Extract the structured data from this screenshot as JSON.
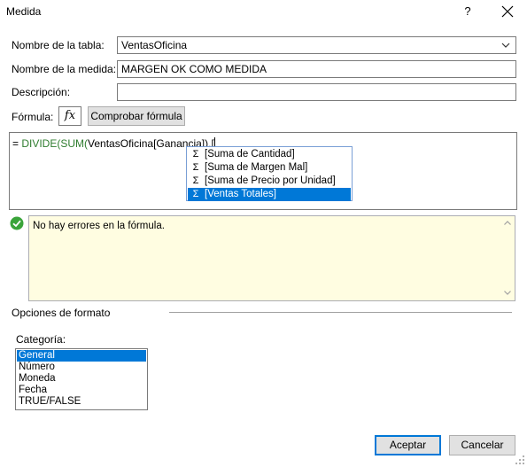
{
  "window": {
    "title": "Medida",
    "help_label": "?"
  },
  "form": {
    "table_name_label": "Nombre de la tabla:",
    "table_name_value": "VentasOficina",
    "measure_name_label": "Nombre de la medida:",
    "measure_name_value": "MARGEN OK COMO MEDIDA",
    "description_label": "Descripción:",
    "description_value": "",
    "formula_label": "Fórmula:",
    "fx_label": "fx",
    "check_formula_label": "Comprobar fórmula"
  },
  "formula": {
    "prefix": "= ",
    "func1": "DIVIDE(",
    "func2": "SUM(",
    "args": "VentasOficina[Ganancia]),["
  },
  "autocomplete": {
    "items": [
      {
        "label": "[Suma de Cantidad]",
        "icon": "sigma-icon"
      },
      {
        "label": "[Suma de Margen Mal]",
        "icon": "sigma-icon"
      },
      {
        "label": "[Suma de Precio por Unidad]",
        "icon": "sigma-icon"
      },
      {
        "label": "[Ventas Totales]",
        "icon": "sigma-icon"
      }
    ],
    "selected_index": 3
  },
  "status": {
    "icon": "check-circle-icon",
    "message": "No hay errores en la fórmula."
  },
  "format": {
    "section_title": "Opciones de formato",
    "category_label": "Categoría:",
    "categories": [
      "General",
      "Número",
      "Moneda",
      "Fecha",
      "TRUE/FALSE"
    ],
    "selected_category": "General"
  },
  "buttons": {
    "accept": "Aceptar",
    "cancel": "Cancelar"
  },
  "colors": {
    "accent": "#0078d7",
    "function_green": "#2f7d2f",
    "errors_bg": "#fffde1",
    "success_green": "#3aa43a"
  }
}
